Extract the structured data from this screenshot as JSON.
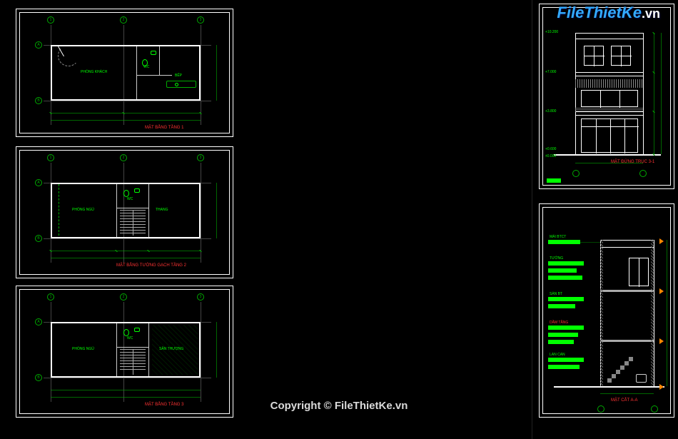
{
  "watermark": {
    "logo_main": "FileThietKe",
    "logo_ext": ".vn",
    "center": "Copyright © FileThietKe.vn"
  },
  "sheets": {
    "plan1": {
      "title": "MẶT BẰNG TẦNG 1",
      "grids": [
        "1",
        "2",
        "3",
        "A",
        "B"
      ],
      "rooms": [
        "PHÒNG KHÁCH",
        "WC",
        "BẾP"
      ]
    },
    "plan2": {
      "title": "MẶT BẰNG TƯỜNG GẠCH TẦNG 2",
      "grids": [
        "1",
        "2",
        "3",
        "A",
        "B"
      ],
      "rooms": [
        "PHÒNG NGỦ",
        "WC",
        "THANG"
      ]
    },
    "plan3": {
      "title": "MẶT BẰNG TẦNG 3",
      "grids": [
        "1",
        "2",
        "3",
        "A",
        "B"
      ],
      "rooms": [
        "PHÒNG NGỦ",
        "WC",
        "SÂN THƯỢNG"
      ]
    },
    "elevation1": {
      "title": "MẶT ĐỨNG TRỤC 3-1",
      "levels": [
        "+10.200",
        "+7.000",
        "+3.800",
        "+0.600",
        "±0.000"
      ]
    },
    "elevation2": {
      "title": "MẶT CẮT A-A",
      "notes": [
        "TƯỜNG",
        "SÀN BT",
        "DẦM TẦNG",
        "MÁI BTCT",
        "LAN CAN"
      ]
    }
  }
}
